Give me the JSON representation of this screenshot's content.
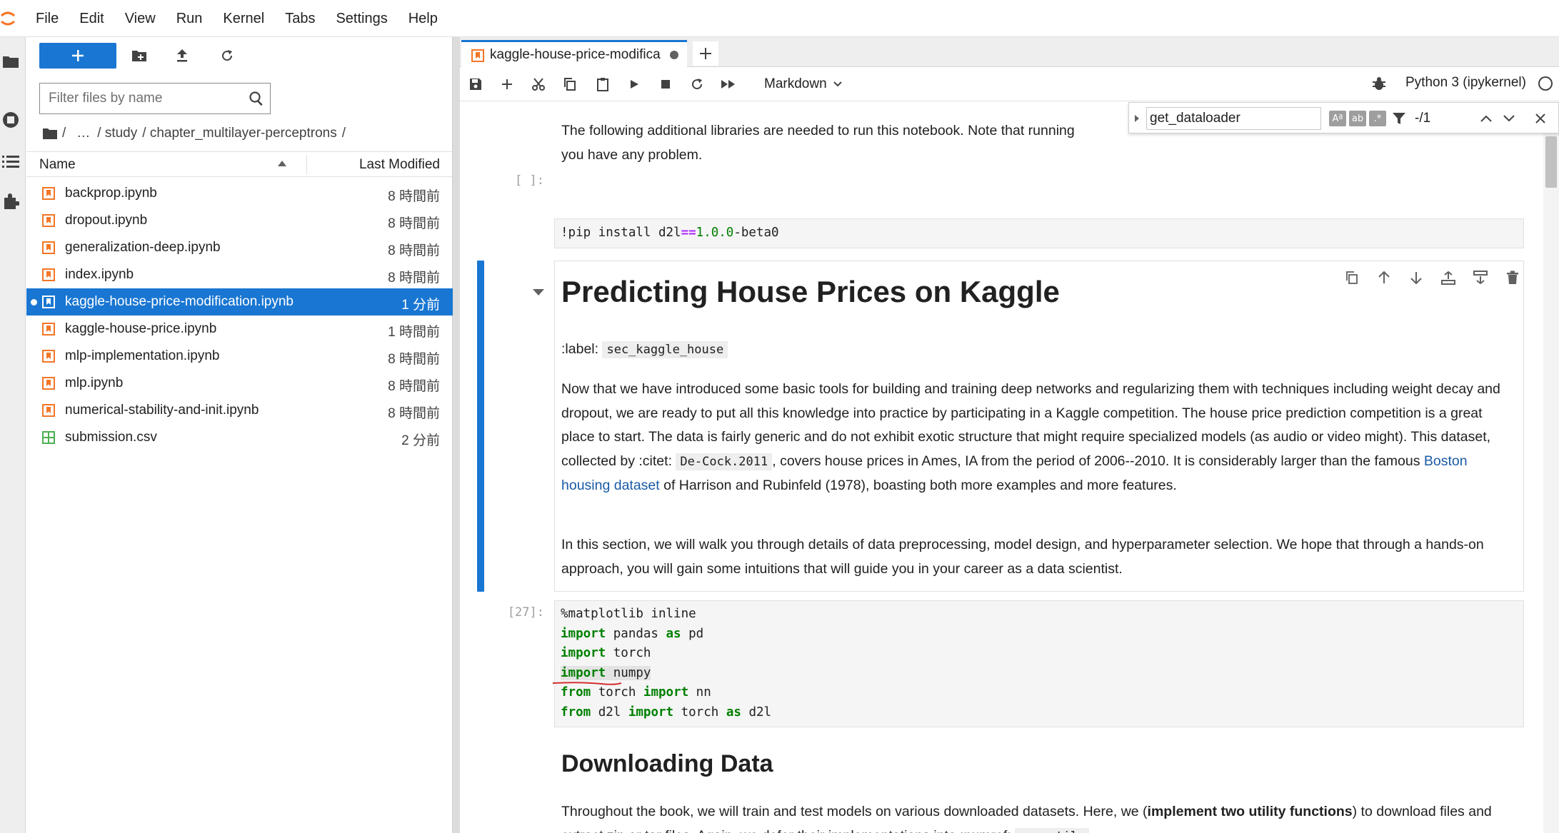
{
  "menubar": {
    "items": [
      "File",
      "Edit",
      "View",
      "Run",
      "Kernel",
      "Tabs",
      "Settings",
      "Help"
    ]
  },
  "activitybar": {
    "icons": [
      "folder-icon",
      "running-icon",
      "toc-icon",
      "extension-icon"
    ]
  },
  "filebrowser": {
    "filter_placeholder": "Filter files by name",
    "breadcrumbs": [
      "/",
      "…",
      "/ study",
      "/ chapter_multilayer-perceptrons",
      "/"
    ],
    "columns": {
      "name": "Name",
      "modified": "Last Modified"
    },
    "files": [
      {
        "name": "backprop.ipynb",
        "modified": "8 時間前",
        "type": "notebook"
      },
      {
        "name": "dropout.ipynb",
        "modified": "8 時間前",
        "type": "notebook"
      },
      {
        "name": "generalization-deep.ipynb",
        "modified": "8 時間前",
        "type": "notebook"
      },
      {
        "name": "index.ipynb",
        "modified": "8 時間前",
        "type": "notebook"
      },
      {
        "name": "kaggle-house-price-modification.ipynb",
        "modified": "1 分前",
        "type": "notebook",
        "selected": true
      },
      {
        "name": "kaggle-house-price.ipynb",
        "modified": "1 時間前",
        "type": "notebook"
      },
      {
        "name": "mlp-implementation.ipynb",
        "modified": "8 時間前",
        "type": "notebook"
      },
      {
        "name": "mlp.ipynb",
        "modified": "8 時間前",
        "type": "notebook"
      },
      {
        "name": "numerical-stability-and-init.ipynb",
        "modified": "8 時間前",
        "type": "notebook"
      },
      {
        "name": "submission.csv",
        "modified": "2 分前",
        "type": "csv"
      }
    ]
  },
  "tab": {
    "label": "kaggle-house-price-modifica"
  },
  "toolbar": {
    "cell_type": "Markdown",
    "kernel": "Python 3 (ipykernel)"
  },
  "search": {
    "query": "get_dataloader",
    "count": "-/1"
  },
  "notebook": {
    "intro_text": "The following additional libraries are needed to run this notebook. Note that running",
    "intro_text2": "you have any problem.",
    "cell1": {
      "prompt": "[ ]:",
      "code_parts": [
        "!pip install d2l",
        "==",
        "1.0.0",
        "-beta0"
      ]
    },
    "heading": "Predicting House Prices on Kaggle",
    "label_prefix": ":label:",
    "label_code": "sec_kaggle_house",
    "para1": {
      "a": "Now that we have introduced some basic tools for building and training deep networks and regularizing them with techniques including weight decay and dropout, we are ready to put all this knowledge into practice by participating in a Kaggle competition. The house price prediction competition is a great place to start. The data is fairly generic and do not exhibit exotic structure that might require specialized models (as audio or video might). This dataset, collected by :citet:",
      "code": "De-Cock.2011",
      "b": ", covers house prices in Ames, IA from the period of 2006--2010. It is considerably larger than the famous",
      "link": "Boston housing dataset",
      "c": "of Harrison and Rubinfeld (1978), boasting both more examples and more features."
    },
    "para2": "In this section, we will walk you through details of data preprocessing, model design, and hyperparameter selection. We hope that through a hands-on approach, you will gain some intuitions that will guide you in your career as a data scientist.",
    "cell2": {
      "prompt": "[27]:",
      "lines": [
        {
          "kw1": "",
          "rest1": "%matplotlib inline"
        },
        {
          "kw1": "import",
          "rest1": " pandas ",
          "kw2": "as",
          "rest2": " pd"
        },
        {
          "kw1": "import",
          "rest1": " torch"
        },
        {
          "kw1": "import",
          "rest1": " numpy"
        },
        {
          "kw1": "from",
          "rest1": " torch ",
          "kw2": "import",
          "rest2": " nn"
        },
        {
          "kw1": "from",
          "rest1": " d2l ",
          "kw2": "import",
          "rest2": " torch ",
          "kw3": "as",
          "rest3": " d2l"
        }
      ]
    },
    "heading2": "Downloading Data",
    "para3": {
      "a": "Throughout the book, we will train and test models on various downloaded datasets. Here, we (",
      "bold": "implement two utility functions",
      "b": ") to download files and extract zip or tar files. Again, we defer their implementations into :numref:",
      "code": "sec_utils",
      "c": "."
    }
  },
  "colors": {
    "accent": "#1976d2",
    "notebook_icon": "#f37626",
    "csv_icon": "#4caf50",
    "keyword": "#008000",
    "annotation": "#d32f2f"
  }
}
